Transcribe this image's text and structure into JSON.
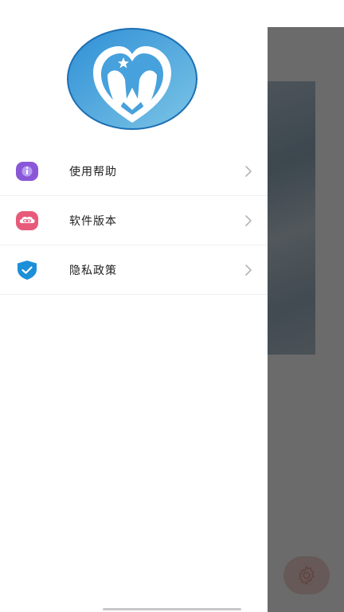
{
  "drawer": {
    "menu_items": [
      {
        "label": "使用帮助",
        "icon": "info-icon",
        "icon_color": "#8a57d8"
      },
      {
        "label": "软件版本",
        "icon": "link-cloud-icon",
        "icon_color": "#e85a7a"
      },
      {
        "label": "隐私政策",
        "icon": "shield-check-icon",
        "icon_color": "#1c8fd8"
      }
    ]
  },
  "background": {
    "settings_button_icon": "gear-icon"
  },
  "colors": {
    "logo_blue": "#2f8fd6",
    "scrim": "rgba(0,0,0,0.58)"
  }
}
